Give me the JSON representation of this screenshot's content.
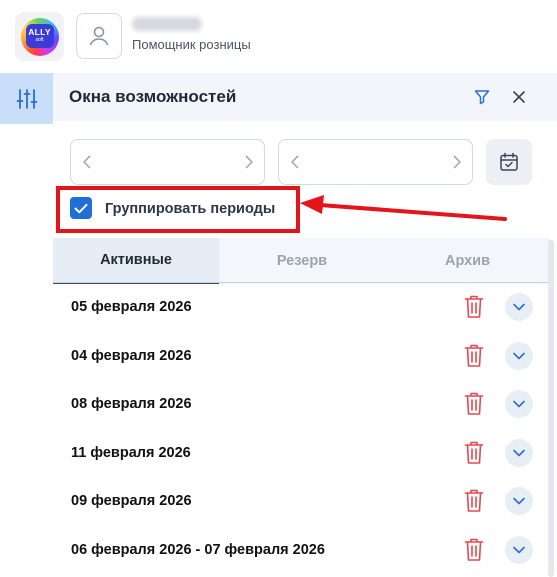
{
  "header": {
    "logo_text": "ALLY",
    "logo_subtext": "soft",
    "user_role": "Помощник розницы"
  },
  "panel": {
    "title": "Окна возможностей",
    "group_periods_label": "Группировать периоды",
    "group_periods_checked": true,
    "tabs": [
      {
        "label": "Активные",
        "active": true
      },
      {
        "label": "Резерв",
        "active": false
      },
      {
        "label": "Архив",
        "active": false
      }
    ],
    "rows": [
      {
        "date": "05 февраля 2026"
      },
      {
        "date": "04 февраля 2026"
      },
      {
        "date": "08 февраля 2026"
      },
      {
        "date": "11 февраля 2026"
      },
      {
        "date": "09 февраля 2026"
      },
      {
        "date": "06 февраля 2026 - 07 февраля 2026"
      }
    ]
  },
  "colors": {
    "accent": "#1f6fd6",
    "highlight_red": "#e4141b",
    "trash_red": "#e5484d",
    "rail_active": "#c8def9"
  },
  "icons": [
    "sliders-icon",
    "filter-icon",
    "close-icon",
    "chevron-left-icon",
    "chevron-right-icon",
    "calendar-icon",
    "check-icon",
    "trash-icon",
    "chevron-down-icon",
    "user-icon"
  ]
}
